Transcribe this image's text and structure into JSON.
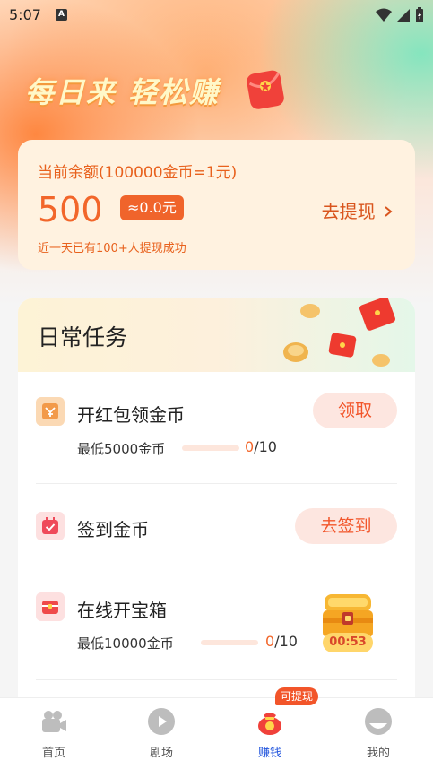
{
  "status_bar": {
    "time": "5:07",
    "notification_icon": "A"
  },
  "hero": {
    "title": "每日来 轻松赚"
  },
  "balance": {
    "label": "当前余额(100000金币=1元)",
    "amount": "500",
    "approx": "≈0.0元",
    "withdraw_label": "去提现",
    "note": "近一天已有100+人提现成功"
  },
  "tasks": {
    "title": "日常任务",
    "items": [
      {
        "name": "开红包领金币",
        "sub": "最低5000金币",
        "progress_current": "0",
        "progress_total": "/10",
        "progress_fraction": 0.0,
        "button": "领取",
        "icon": "red-envelope-icon"
      },
      {
        "name": "签到金币",
        "button": "去签到",
        "icon": "calendar-check-icon"
      },
      {
        "name": "在线开宝箱",
        "sub": "最低10000金币",
        "progress_current": "0",
        "progress_total": "/10",
        "progress_fraction": 0.0,
        "timer": "00:53",
        "icon": "treasure-box-icon"
      }
    ]
  },
  "bottom_nav": {
    "badge": "可提现",
    "items": [
      {
        "label": "首页",
        "icon": "video-camera-icon"
      },
      {
        "label": "剧场",
        "icon": "play-icon"
      },
      {
        "label": "赚钱",
        "icon": "money-bag-icon",
        "active": true
      },
      {
        "label": "我的",
        "icon": "profile-icon"
      }
    ]
  },
  "colors": {
    "accent": "#f2662a",
    "nav_active": "#2255dd"
  }
}
